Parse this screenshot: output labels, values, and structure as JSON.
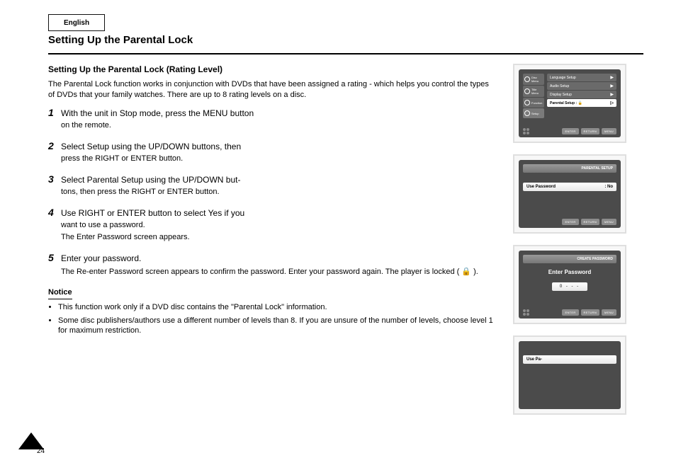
{
  "page": {
    "tab": "English",
    "heading": "Setting Up the Parental Lock",
    "subtitle": "Setting Up the Parental Lock (Rating Level)",
    "intro": "The Parental Lock function works in conjunction with DVDs that have been assigned a rating - which helps you control the types of DVDs that your family watches. There are up to 8 rating levels on a disc.",
    "steps": [
      {
        "num": "1",
        "lines": [
          "With the unit in Stop mode, press the MENU button",
          "on the remote."
        ]
      },
      {
        "num": "2",
        "lines": [
          "Select Setup using the UP/DOWN buttons, then",
          "press the RIGHT or ENTER button."
        ]
      },
      {
        "num": "3",
        "lines": [
          "Select Parental Setup using the UP/DOWN but-",
          "tons, then press the RIGHT or ENTER button."
        ]
      },
      {
        "num": "4",
        "lines": [
          "Use RIGHT or ENTER button to select Yes if you",
          "want to use a password.",
          "The Enter Password screen appears."
        ]
      },
      {
        "num": "5",
        "lines": [
          "Enter your password."
        ],
        "detail": "The Re-enter Password screen appears to confirm the password. Enter your password again. The player is locked ( 🔒 )."
      }
    ],
    "notice": {
      "title": "Notice",
      "items": [
        "This function work only if a DVD disc contains the \"Parental Lock\" information.",
        "Some disc publishers/authors use a different number of levels than 8. If you are unsure of the number of levels, choose level 1 for maximum restriction."
      ]
    },
    "pageNumber": "24"
  },
  "screens": {
    "setupMenu": {
      "side": [
        {
          "label": "Disc Menu"
        },
        {
          "label": "Title Menu"
        },
        {
          "label": "Function"
        },
        {
          "label": "Setup",
          "selected": true
        }
      ],
      "main": [
        {
          "label": "Language Setup",
          "arrow": "▶"
        },
        {
          "label": "Audio Setup",
          "arrow": "▶"
        },
        {
          "label": "Display Setup",
          "arrow": "▶"
        },
        {
          "label": "Parental Setup :",
          "arrow": "▷",
          "highlight": true,
          "extra": "🔓"
        }
      ],
      "buttons": [
        "ENTER",
        "RETURN",
        "MENU"
      ]
    },
    "parentalSetup": {
      "title": "PARENTAL SETUP",
      "field": {
        "label": "Use Password",
        "value": "No"
      },
      "buttons": [
        "ENTER",
        "RETURN",
        "MENU"
      ]
    },
    "createPassword": {
      "title": "CREATE PASSWORD",
      "prompt": "Enter Password",
      "mask": "0 - - -",
      "buttons": [
        "ENTER",
        "RETURN",
        "MENU"
      ]
    },
    "lockedRow": {
      "label": "Use Pa-",
      "buttons": []
    }
  }
}
